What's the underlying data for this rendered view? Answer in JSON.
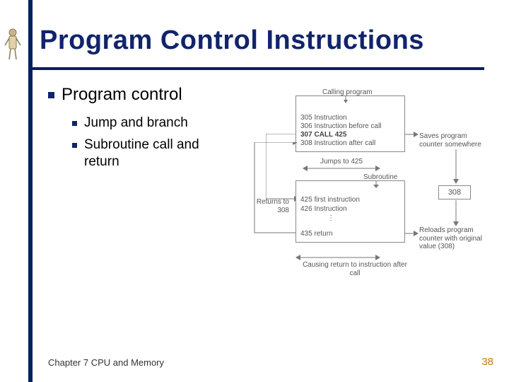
{
  "title": "Program Control Instructions",
  "bullets": {
    "lvl1": "Program control",
    "sub1": "Jump and branch",
    "sub2": "Subroutine call and return"
  },
  "diagram": {
    "calling_label": "Calling program",
    "l305": "305 Instruction",
    "l306": "306 Instruction before call",
    "l307": "307 CALL 425",
    "l308": "308 Instruction after call",
    "saves": "Saves program counter somewhere",
    "jumps": "Jumps to 425",
    "sub_label": "Subroutine",
    "l425": "425 first instruction",
    "l426": "426 Instruction",
    "l435": "435 return",
    "box308": "308",
    "returns": "Returns to 308",
    "reloads": "Reloads program counter with original value (308)",
    "cause": "Causing return to instruction after call"
  },
  "footer": {
    "chapter": "Chapter 7 CPU and Memory",
    "page": "38"
  }
}
